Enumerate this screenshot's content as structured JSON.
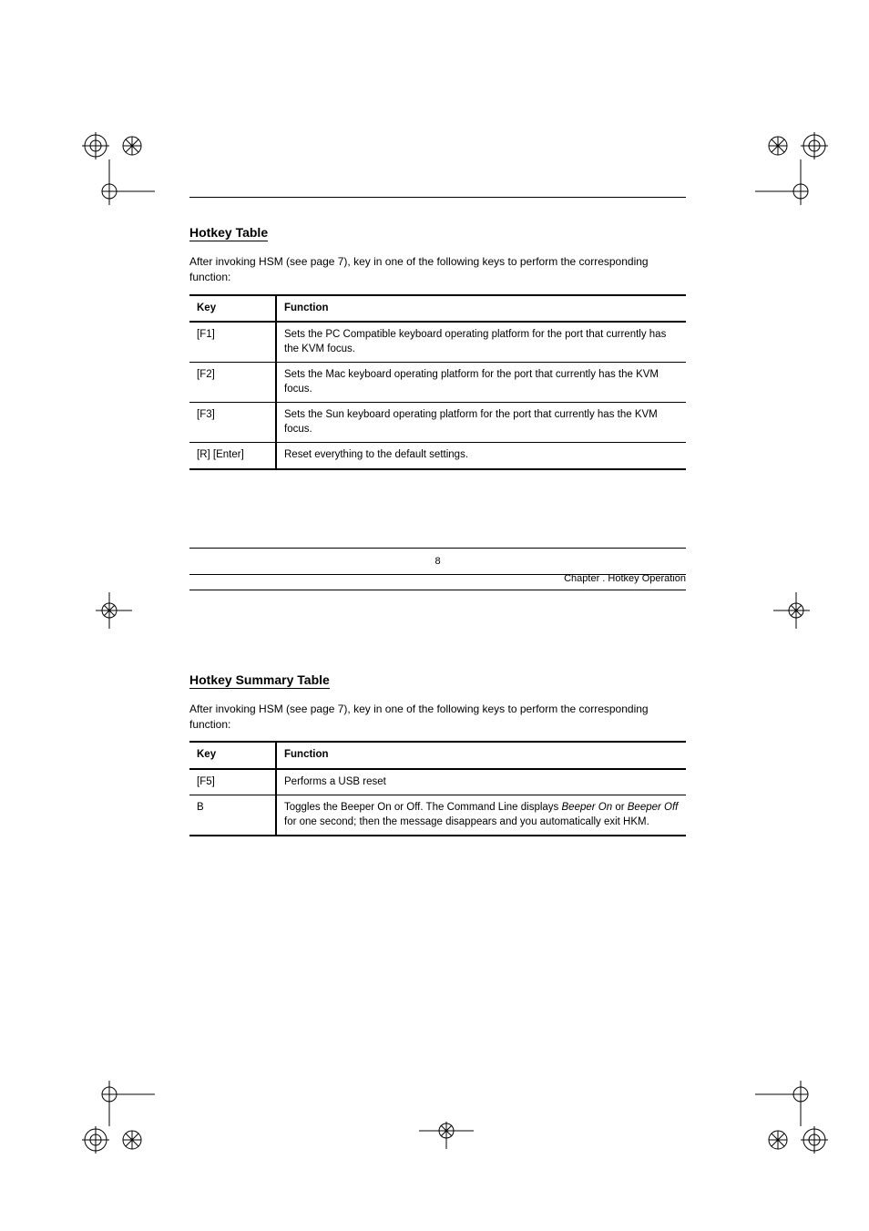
{
  "section1": {
    "title": "Hotkey Table",
    "intro": "After invoking HSM (see page 7), key in one of the following keys to perform the corresponding function:",
    "table": {
      "headers": [
        "Key",
        "Function"
      ],
      "rows": [
        {
          "key": "[F1]",
          "fn": "Sets the PC Compatible keyboard operating platform for the port that currently has the KVM focus."
        },
        {
          "key": "[F2]",
          "fn": "Sets the Mac keyboard operating platform for the port that currently has the KVM focus."
        },
        {
          "key": "[F3]",
          "fn": "Sets the Sun keyboard operating platform for the port that currently has the KVM focus."
        },
        {
          "key": "[R] [Enter]",
          "fn": "Reset everything to the default settings."
        }
      ]
    }
  },
  "pageNumber": "8",
  "runningHead": "Chapter . Hotkey Operation",
  "section2": {
    "title": "Hotkey Summary Table",
    "intro": "After invoking HSM (see page 7), key in one of the following keys to perform the corresponding function:",
    "table": {
      "headers": [
        "Key",
        "Function"
      ],
      "rows": [
        {
          "key": "[F5]",
          "fn": "Performs a USB reset"
        },
        {
          "key": "B",
          "fn_pre": "Toggles the Beeper On or Off. The Command Line displays ",
          "fn_it1": "Beeper On",
          "fn_mid": " or ",
          "fn_it2": "Beeper Off",
          "fn_post": " for one second; then the message disappears and you automatically exit HKM."
        }
      ]
    }
  }
}
